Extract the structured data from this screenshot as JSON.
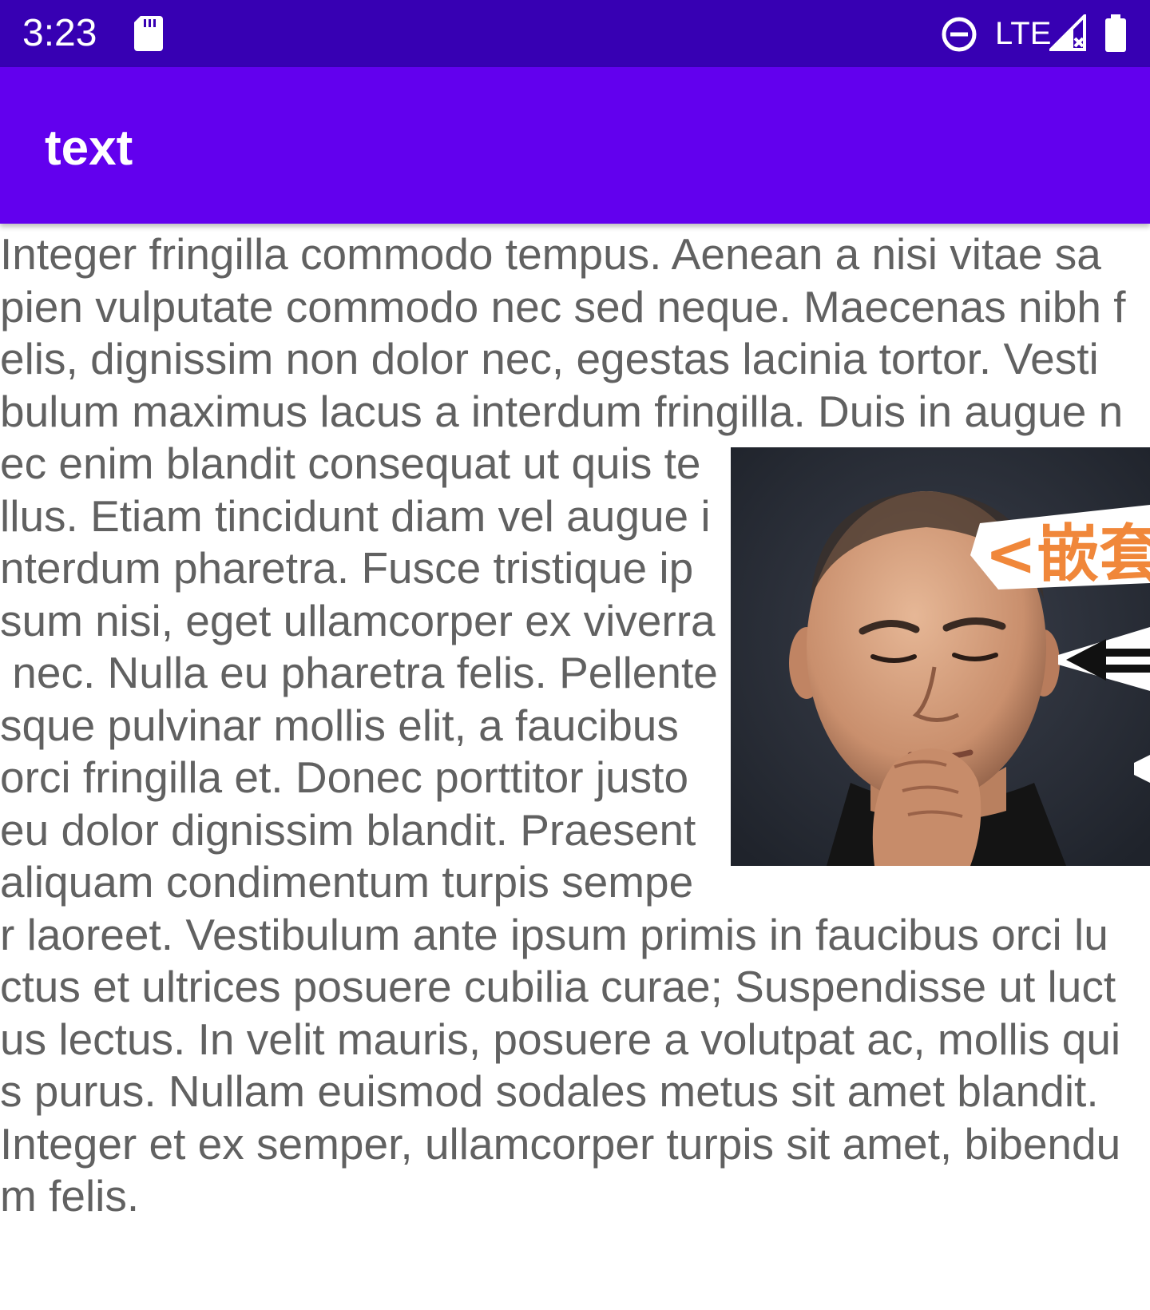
{
  "status_bar": {
    "time": "3:23",
    "network": "LTE",
    "icons": [
      "sd-card-icon",
      "do-not-disturb-icon",
      "cell-signal-icon",
      "battery-icon"
    ]
  },
  "app_bar": {
    "title": "text",
    "color": "#6200EE",
    "status_color": "#3700B3"
  },
  "content": {
    "lines": [
      "Integer fringilla commodo tempus. Aenean a nisi vitae sa",
      "pien vulputate commodo nec sed neque. Maecenas nibh f",
      "elis, dignissim non dolor nec, egestas lacinia tortor. Vesti",
      "bulum maximus lacus a interdum fringilla. Duis in augue n",
      "ec enim blandit consequat ut quis te",
      "llus. Etiam tincidunt diam vel augue i",
      "nterdum pharetra. Fusce tristique ip",
      "sum nisi, eget ullamcorper ex viverra",
      " nec. Nulla eu pharetra felis. Pellente",
      "sque pulvinar mollis elit, a faucibus",
      "orci fringilla et. Donec porttitor justo",
      "eu dolor dignissim blandit. Praesent",
      "aliquam condimentum turpis sempe",
      "r laoreet. Vestibulum ante ipsum primis in faucibus orci lu",
      "ctus et ultrices posuere cubilia curae; Suspendisse ut luct",
      "us lectus. In velit mauris, posuere a volutpat ac, mollis qui",
      "s purus. Nullam euismod sodales metus sit amet blandit.",
      "Integer et ex semper, ullamcorper turpis sit amet, bibendu",
      "m felis."
    ],
    "image_caption_text": "<嵌套"
  }
}
